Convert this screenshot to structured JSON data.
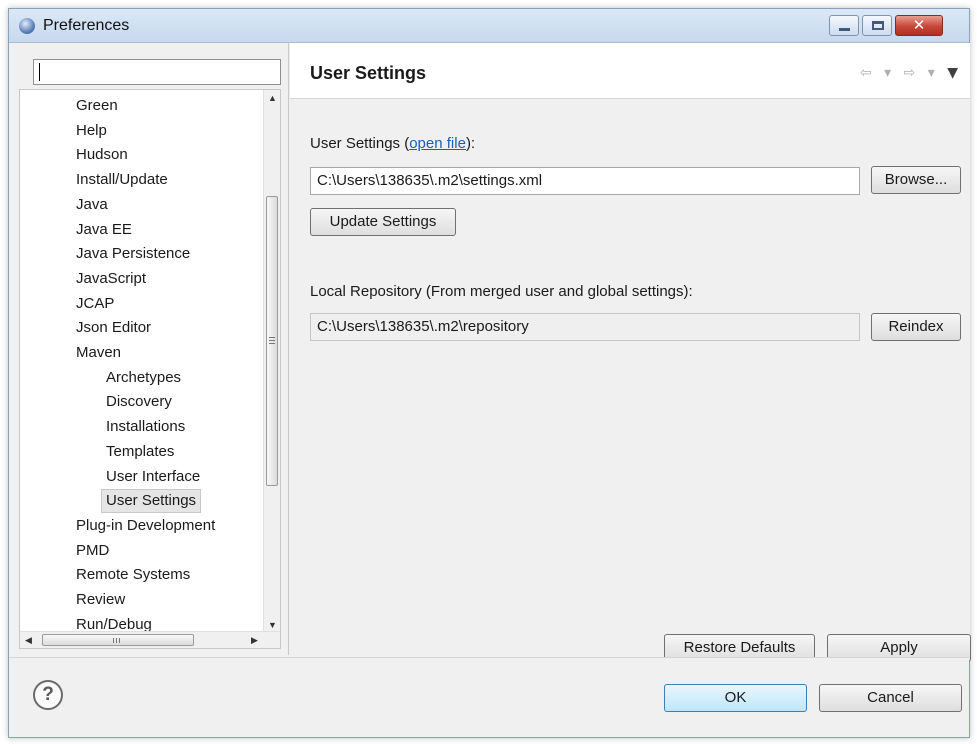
{
  "window": {
    "title": "Preferences",
    "controls": {
      "minimize": "minimize",
      "maximize": "maximize",
      "close": "✕"
    }
  },
  "filter": {
    "value": "",
    "placeholder": ""
  },
  "tree": {
    "items": [
      {
        "label": "Green",
        "level": 0
      },
      {
        "label": "Help",
        "level": 0
      },
      {
        "label": "Hudson",
        "level": 0
      },
      {
        "label": "Install/Update",
        "level": 0
      },
      {
        "label": "Java",
        "level": 0
      },
      {
        "label": "Java EE",
        "level": 0
      },
      {
        "label": "Java Persistence",
        "level": 0
      },
      {
        "label": "JavaScript",
        "level": 0
      },
      {
        "label": "JCAP",
        "level": 0
      },
      {
        "label": "Json Editor",
        "level": 0
      },
      {
        "label": "Maven",
        "level": 0
      },
      {
        "label": "Archetypes",
        "level": 1
      },
      {
        "label": "Discovery",
        "level": 1
      },
      {
        "label": "Installations",
        "level": 1
      },
      {
        "label": "Templates",
        "level": 1
      },
      {
        "label": "User Interface",
        "level": 1
      },
      {
        "label": "User Settings",
        "level": 1,
        "selected": true
      },
      {
        "label": "Plug-in Development",
        "level": 0
      },
      {
        "label": "PMD",
        "level": 0
      },
      {
        "label": "Remote Systems",
        "level": 0
      },
      {
        "label": "Review",
        "level": 0
      },
      {
        "label": "Run/Debug",
        "level": 0
      }
    ]
  },
  "page": {
    "title": "User Settings",
    "nav": {
      "back": "⇦",
      "back_menu": "▾",
      "forward": "⇨",
      "forward_menu": "▾",
      "view_menu": "▼"
    },
    "user_settings_label": "User Settings",
    "open_file_prefix": "(",
    "open_file_link": "open file",
    "open_file_suffix": "):",
    "settings_path": "C:\\Users\\138635\\.m2\\settings.xml",
    "browse_button": "Browse...",
    "update_button": "Update Settings",
    "local_repo_label": "Local Repository (From merged user and global settings):",
    "local_repo_path": "C:\\Users\\138635\\.m2\\repository",
    "reindex_button": "Reindex",
    "restore_defaults_button": "Restore Defaults",
    "apply_button": "Apply"
  },
  "footer": {
    "help": "?",
    "ok_button": "OK",
    "cancel_button": "Cancel"
  }
}
